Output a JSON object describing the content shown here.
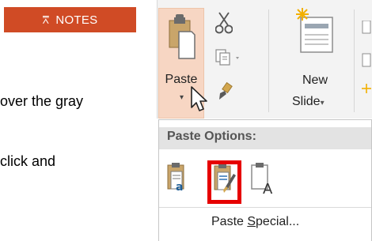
{
  "notes_button": {
    "icon": "⩞",
    "label": "NOTES",
    "color": "#D04B25"
  },
  "doc_text": {
    "line1": "over the gray",
    "line2": "click and"
  },
  "ribbon": {
    "paste_label": "Paste",
    "new_slide_line1": "New",
    "new_slide_line2": "Slide",
    "dropdown_caret": "▾"
  },
  "paste_menu": {
    "title": "Paste Options:",
    "special_prefix": "Paste ",
    "special_accel": "S",
    "special_rest": "pecial..."
  },
  "highlight_color": "#E60000"
}
